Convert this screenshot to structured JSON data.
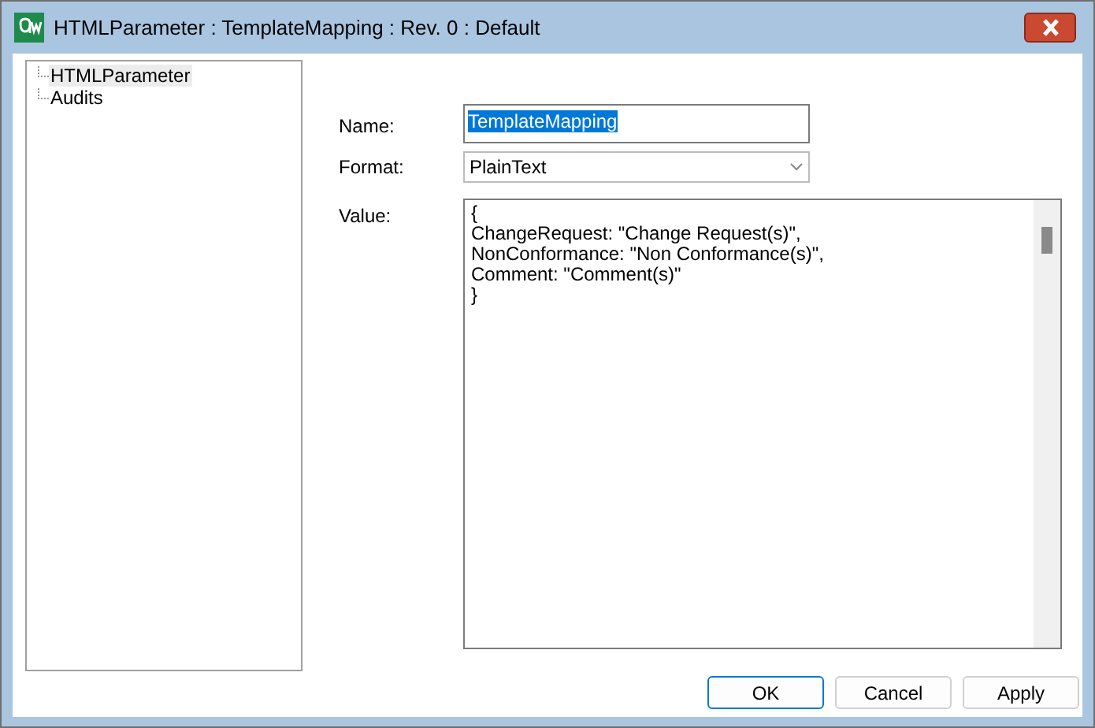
{
  "window": {
    "title": "HTMLParameter : TemplateMapping : Rev. 0  : Default"
  },
  "tree": {
    "items": [
      {
        "label": "HTMLParameter",
        "selected": true
      },
      {
        "label": "Audits",
        "selected": false
      }
    ]
  },
  "form": {
    "name": {
      "label": "Name:",
      "value": "TemplateMapping",
      "text_selected": true
    },
    "format": {
      "label": "Format:",
      "value": "PlainText"
    },
    "value": {
      "label": "Value:",
      "lines": [
        "{",
        "ChangeRequest: \"Change Request(s)\",",
        "NonConformance: \"Non Conformance(s)\",",
        "Comment: \"Comment(s)\"",
        "}"
      ]
    }
  },
  "buttons": [
    {
      "label": "OK",
      "default": true
    },
    {
      "label": "Cancel",
      "default": false
    },
    {
      "label": "Apply",
      "default": false
    }
  ]
}
